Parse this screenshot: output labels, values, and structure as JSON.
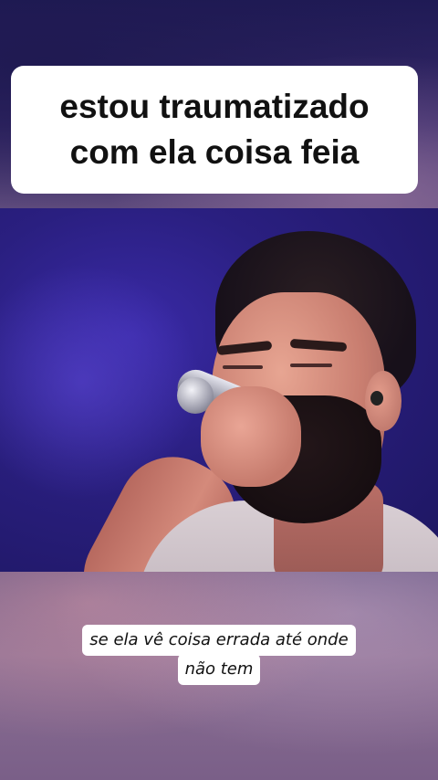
{
  "overlay": {
    "title_lines": [
      "estou traumatizado",
      "com ela coisa feia"
    ],
    "subtitle_lines": [
      "se ela vê coisa errada até onde",
      "não tem"
    ]
  },
  "colors": {
    "caption_background": "#ffffff",
    "caption_text": "#111111",
    "stage_light": "#2a1f80",
    "backdrop_top": "#1f1a55",
    "backdrop_bottom": "#7a5f88"
  },
  "icons": {
    "microphone": "microphone-icon",
    "earpiece": "in-ear-monitor-icon"
  }
}
